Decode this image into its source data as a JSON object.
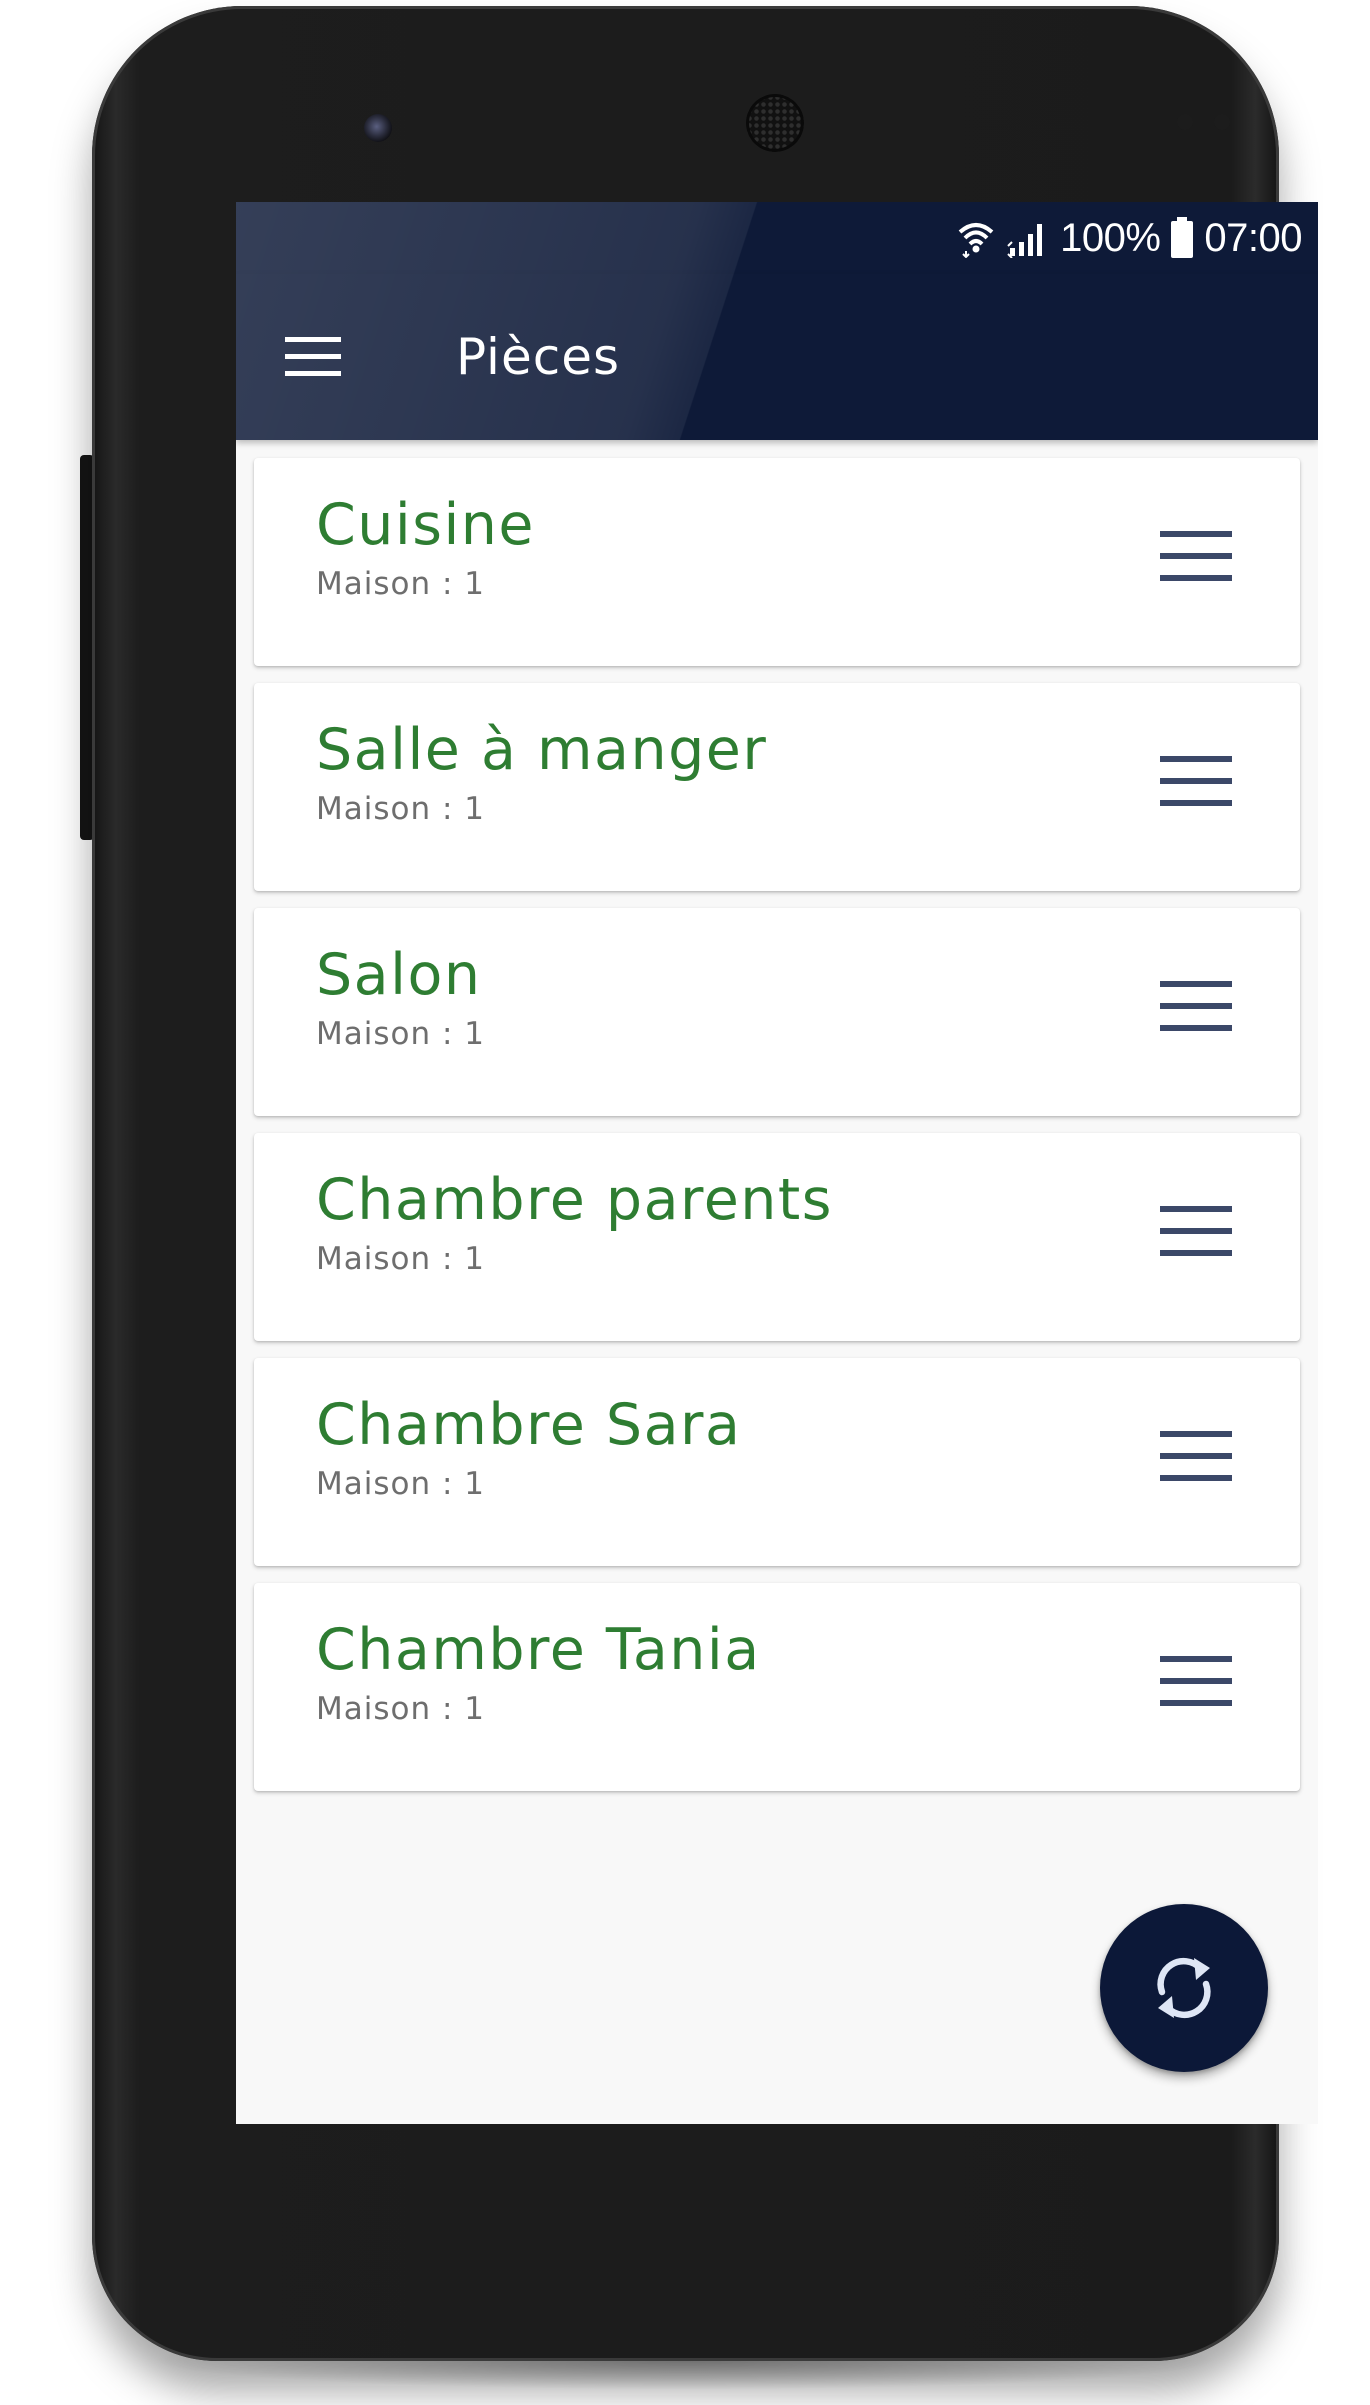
{
  "status_bar": {
    "battery_percent": "100%",
    "time": "07:00",
    "icons": [
      "wifi-icon",
      "signal-icon",
      "battery-icon"
    ]
  },
  "app_bar": {
    "title": "Pièces",
    "menu_icon": "hamburger-menu-icon"
  },
  "rooms": [
    {
      "name": "Cuisine",
      "subtitle": "Maison : 1"
    },
    {
      "name": "Salle à manger",
      "subtitle": "Maison : 1"
    },
    {
      "name": "Salon",
      "subtitle": "Maison : 1"
    },
    {
      "name": "Chambre parents",
      "subtitle": "Maison : 1"
    },
    {
      "name": "Chambre Sara",
      "subtitle": "Maison : 1"
    },
    {
      "name": "Chambre Tania",
      "subtitle": "Maison : 1"
    }
  ],
  "fab": {
    "icon": "sync-icon"
  },
  "colors": {
    "app_bar": "#0e1a38",
    "room_name": "#2e7d32",
    "subtitle": "#6e6e6e",
    "drag_handle": "#3b4868",
    "fab": "#0c1838",
    "background": "#f8f8f8"
  }
}
